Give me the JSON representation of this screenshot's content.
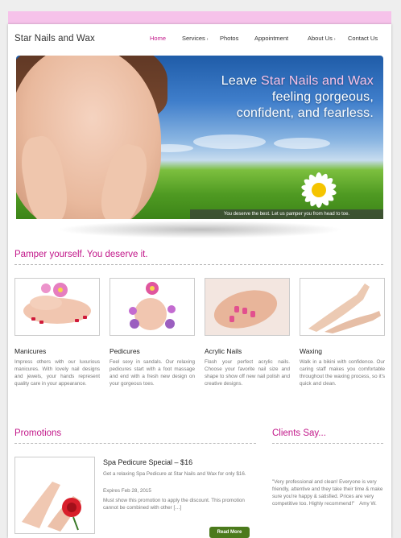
{
  "site": {
    "title": "Star Nails and Wax"
  },
  "nav": {
    "items": [
      {
        "label": "Home",
        "active": true
      },
      {
        "label": "Services",
        "has_submenu": true
      },
      {
        "label": "Photos"
      },
      {
        "label": "Appointment"
      },
      {
        "label": "About Us",
        "has_submenu": true
      },
      {
        "label": "Contact Us"
      }
    ],
    "submenu_arrow": "›"
  },
  "hero": {
    "line1_prefix": "Leave ",
    "line1_brand": "Star Nails and Wax",
    "line2": "feeling gorgeous,",
    "line3": "confident, and fearless.",
    "caption": "You deserve the best. Let us pamper you from head to toe."
  },
  "services": {
    "heading": "Pamper yourself. You deserve it.",
    "cards": [
      {
        "title": "Manicures",
        "text": "Impress others with our luxurious manicures. With lovely nail designs and jewels, your hands represent quality care in your appearance."
      },
      {
        "title": "Pedicures",
        "text": "Feel sexy in sandals. Our relaxing pedicures start with a foot massage and end with a fresh new design on your gorgeous toes."
      },
      {
        "title": "Acrylic Nails",
        "text": "Flash your perfect acrylic nails. Choose your favorite nail size and shape to show off new nail polish and creative designs."
      },
      {
        "title": "Waxing",
        "text": "Walk in a bikini with confidence. Our caring staff makes you comfortable throughout the waxing process, so it's quick and clean."
      }
    ]
  },
  "promotions": {
    "heading": "Promotions",
    "title": "Spa Pedicure Special – $16",
    "text": "Get a relaxing Spa Pedicure at Star Nails and Wax for only $16.",
    "expires": "Expires Feb 28, 2015",
    "mention": "Must show this promotion to apply the discount. This promotion cannot be combined with other […]",
    "button": "Read More"
  },
  "clients": {
    "heading": "Clients Say...",
    "quote": "\"Very professional and clean! Everyone is very friendly, attentive and they take their time & make sure you're happy & satisfied. Prices are very competitive too. Highly recommend!\"",
    "author": "Amy W."
  },
  "colors": {
    "accent": "#c2188a",
    "topbar": "#f6c2ea",
    "button": "#4b7a1c"
  }
}
